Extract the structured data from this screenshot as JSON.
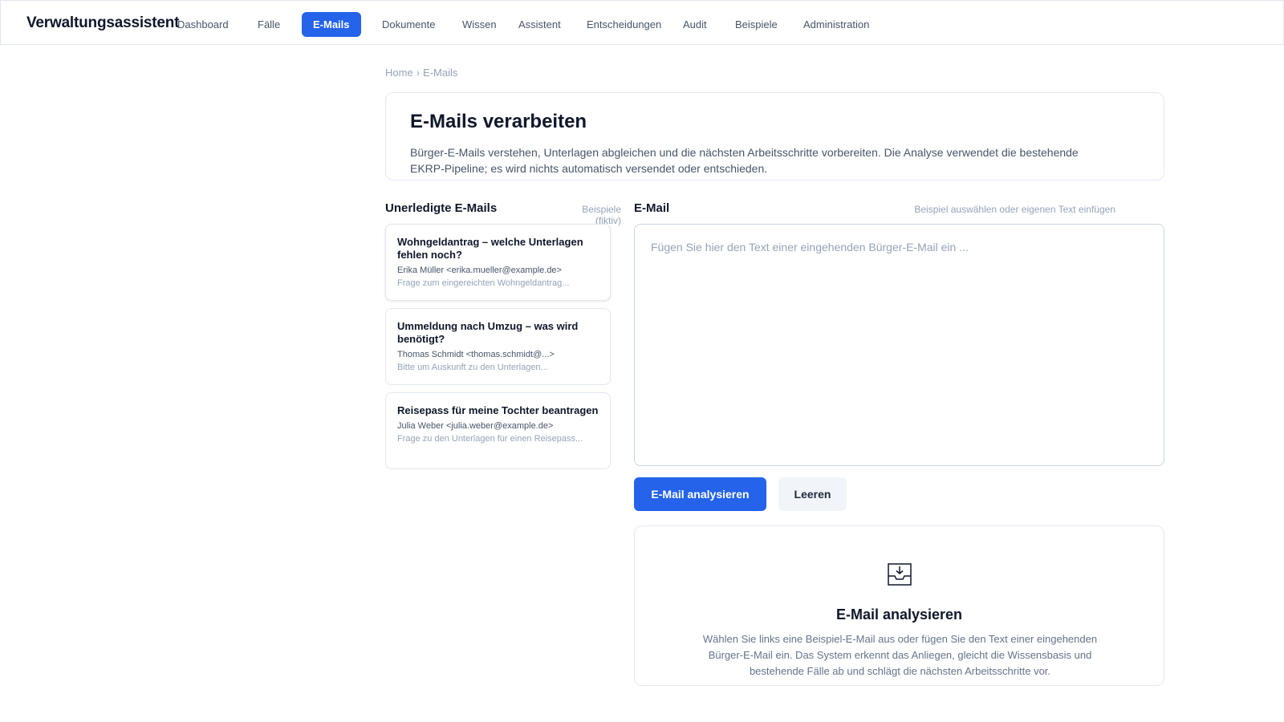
{
  "app": {
    "brand": "Verwaltungsassistent"
  },
  "nav": {
    "items": [
      {
        "label": "Dashboard"
      },
      {
        "label": "Fälle"
      },
      {
        "label": "E-Mails",
        "active": true
      },
      {
        "label": "Dokumente"
      },
      {
        "label": "Wissen"
      },
      {
        "label": "Assistent"
      },
      {
        "label": "Entscheidungen"
      },
      {
        "label": "Audit"
      },
      {
        "label": "Beispiele"
      },
      {
        "label": "Administration"
      }
    ],
    "active_color": "#2563eb"
  },
  "breadcrumb": {
    "home": "Home",
    "separator": "›",
    "current": "E-Mails"
  },
  "header": {
    "title": "E-Mails verarbeiten",
    "description": "Bürger-E-Mails verstehen, Unterlagen abgleichen und die nächsten Arbeitsschritte vorbereiten. Die Analyse verwendet die bestehende EKRP-Pipeline; es wird nichts automatisch versendet oder entschieden."
  },
  "inbox": {
    "title": "Unerledigte E-Mails",
    "hint": "Beispiele (fiktiv)",
    "emails": [
      {
        "subject": "Wohngeldantrag – welche Unterlagen fehlen noch?",
        "from": "Erika Müller <erika.mueller@example.de>",
        "snippet": "Frage zum eingereichten Wohngeldantrag..."
      },
      {
        "subject": "Ummeldung nach Umzug – was wird benötigt?",
        "from": "Thomas Schmidt <thomas.schmidt@...>",
        "snippet": "Bitte um Auskunft zu den Unterlagen..."
      },
      {
        "subject": "Reisepass für meine Tochter beantragen",
        "from": "Julia Weber <julia.weber@example.de>",
        "snippet": "Frage zu den Unterlagen für einen Reisepass..."
      }
    ]
  },
  "editor": {
    "title": "E-Mail",
    "hint": "Beispiel auswählen oder eigenen Text einfügen",
    "value": "",
    "placeholder": "Fügen Sie hier den Text einer eingehenden Bürger-E-Mail ein ..."
  },
  "actions": {
    "analyze_label": "E-Mail analysieren",
    "clear_label": "Leeren"
  },
  "empty_state": {
    "icon": "inbox-tray-icon",
    "title": "E-Mail analysieren",
    "text": "Wählen Sie links eine Beispiel-E-Mail aus oder fügen Sie den Text einer eingehenden Bürger-E-Mail ein. Das System erkennt das Anliegen, gleicht die Wissensbasis und bestehende Fälle ab und schlägt die nächsten Arbeitsschritte vor."
  }
}
